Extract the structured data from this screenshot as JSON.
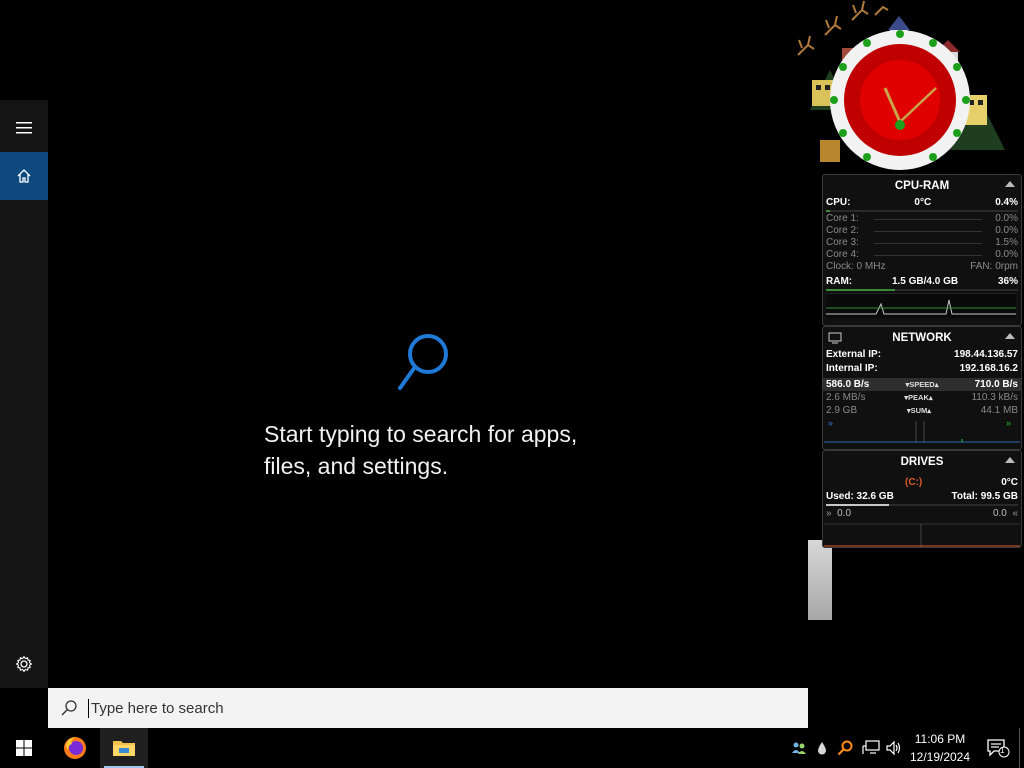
{
  "search": {
    "hint": "Start typing to search for apps, files, and settings.",
    "placeholder": "Type here to search"
  },
  "rail": {
    "items": [
      "hamburger-menu",
      "home",
      "settings"
    ]
  },
  "cpu_ram": {
    "title": "CPU-RAM",
    "cpu_label": "CPU:",
    "cpu_temp": "0°C",
    "cpu_pct": "0.4%",
    "cores": [
      {
        "label": "Core 1:",
        "value": "0.0%"
      },
      {
        "label": "Core 2:",
        "value": "0.0%"
      },
      {
        "label": "Core 3:",
        "value": "1.5%"
      },
      {
        "label": "Core 4:",
        "value": "0.0%"
      }
    ],
    "clock": "Clock: 0 MHz",
    "fan": "FAN: 0rpm",
    "ram_label": "RAM:",
    "ram_usage": "1.5 GB/4.0 GB",
    "ram_pct": "36%",
    "ram_fill": 0.36
  },
  "network": {
    "title": "NETWORK",
    "external_label": "External IP:",
    "external_ip": "198.44.136.57",
    "internal_label": "Internal IP:",
    "internal_ip": "192.168.16.2",
    "speed_down": "586.0 B/s",
    "speed_label": "SPEED",
    "speed_up": "710.0 B/s",
    "peak_down": "2.6 MB/s",
    "peak_label": "PEAK",
    "peak_up": "110.3 kB/s",
    "sum_down": "2.9 GB",
    "sum_label": "SUM",
    "sum_up": "44.1 MB"
  },
  "drives": {
    "title": "DRIVES",
    "drive_letter": "(C:)",
    "temp": "0°C",
    "used": "Used: 32.6 GB",
    "total": "Total: 99.5 GB",
    "read": "0.0",
    "write": "0.0"
  },
  "taskbar": {
    "time": "11:06 PM",
    "date": "12/19/2024",
    "notif_count": "1"
  },
  "colors": {
    "accent": "#0f4a7e",
    "search_icon": "#1e7ad6",
    "drive_letter": "#e05a2a"
  }
}
